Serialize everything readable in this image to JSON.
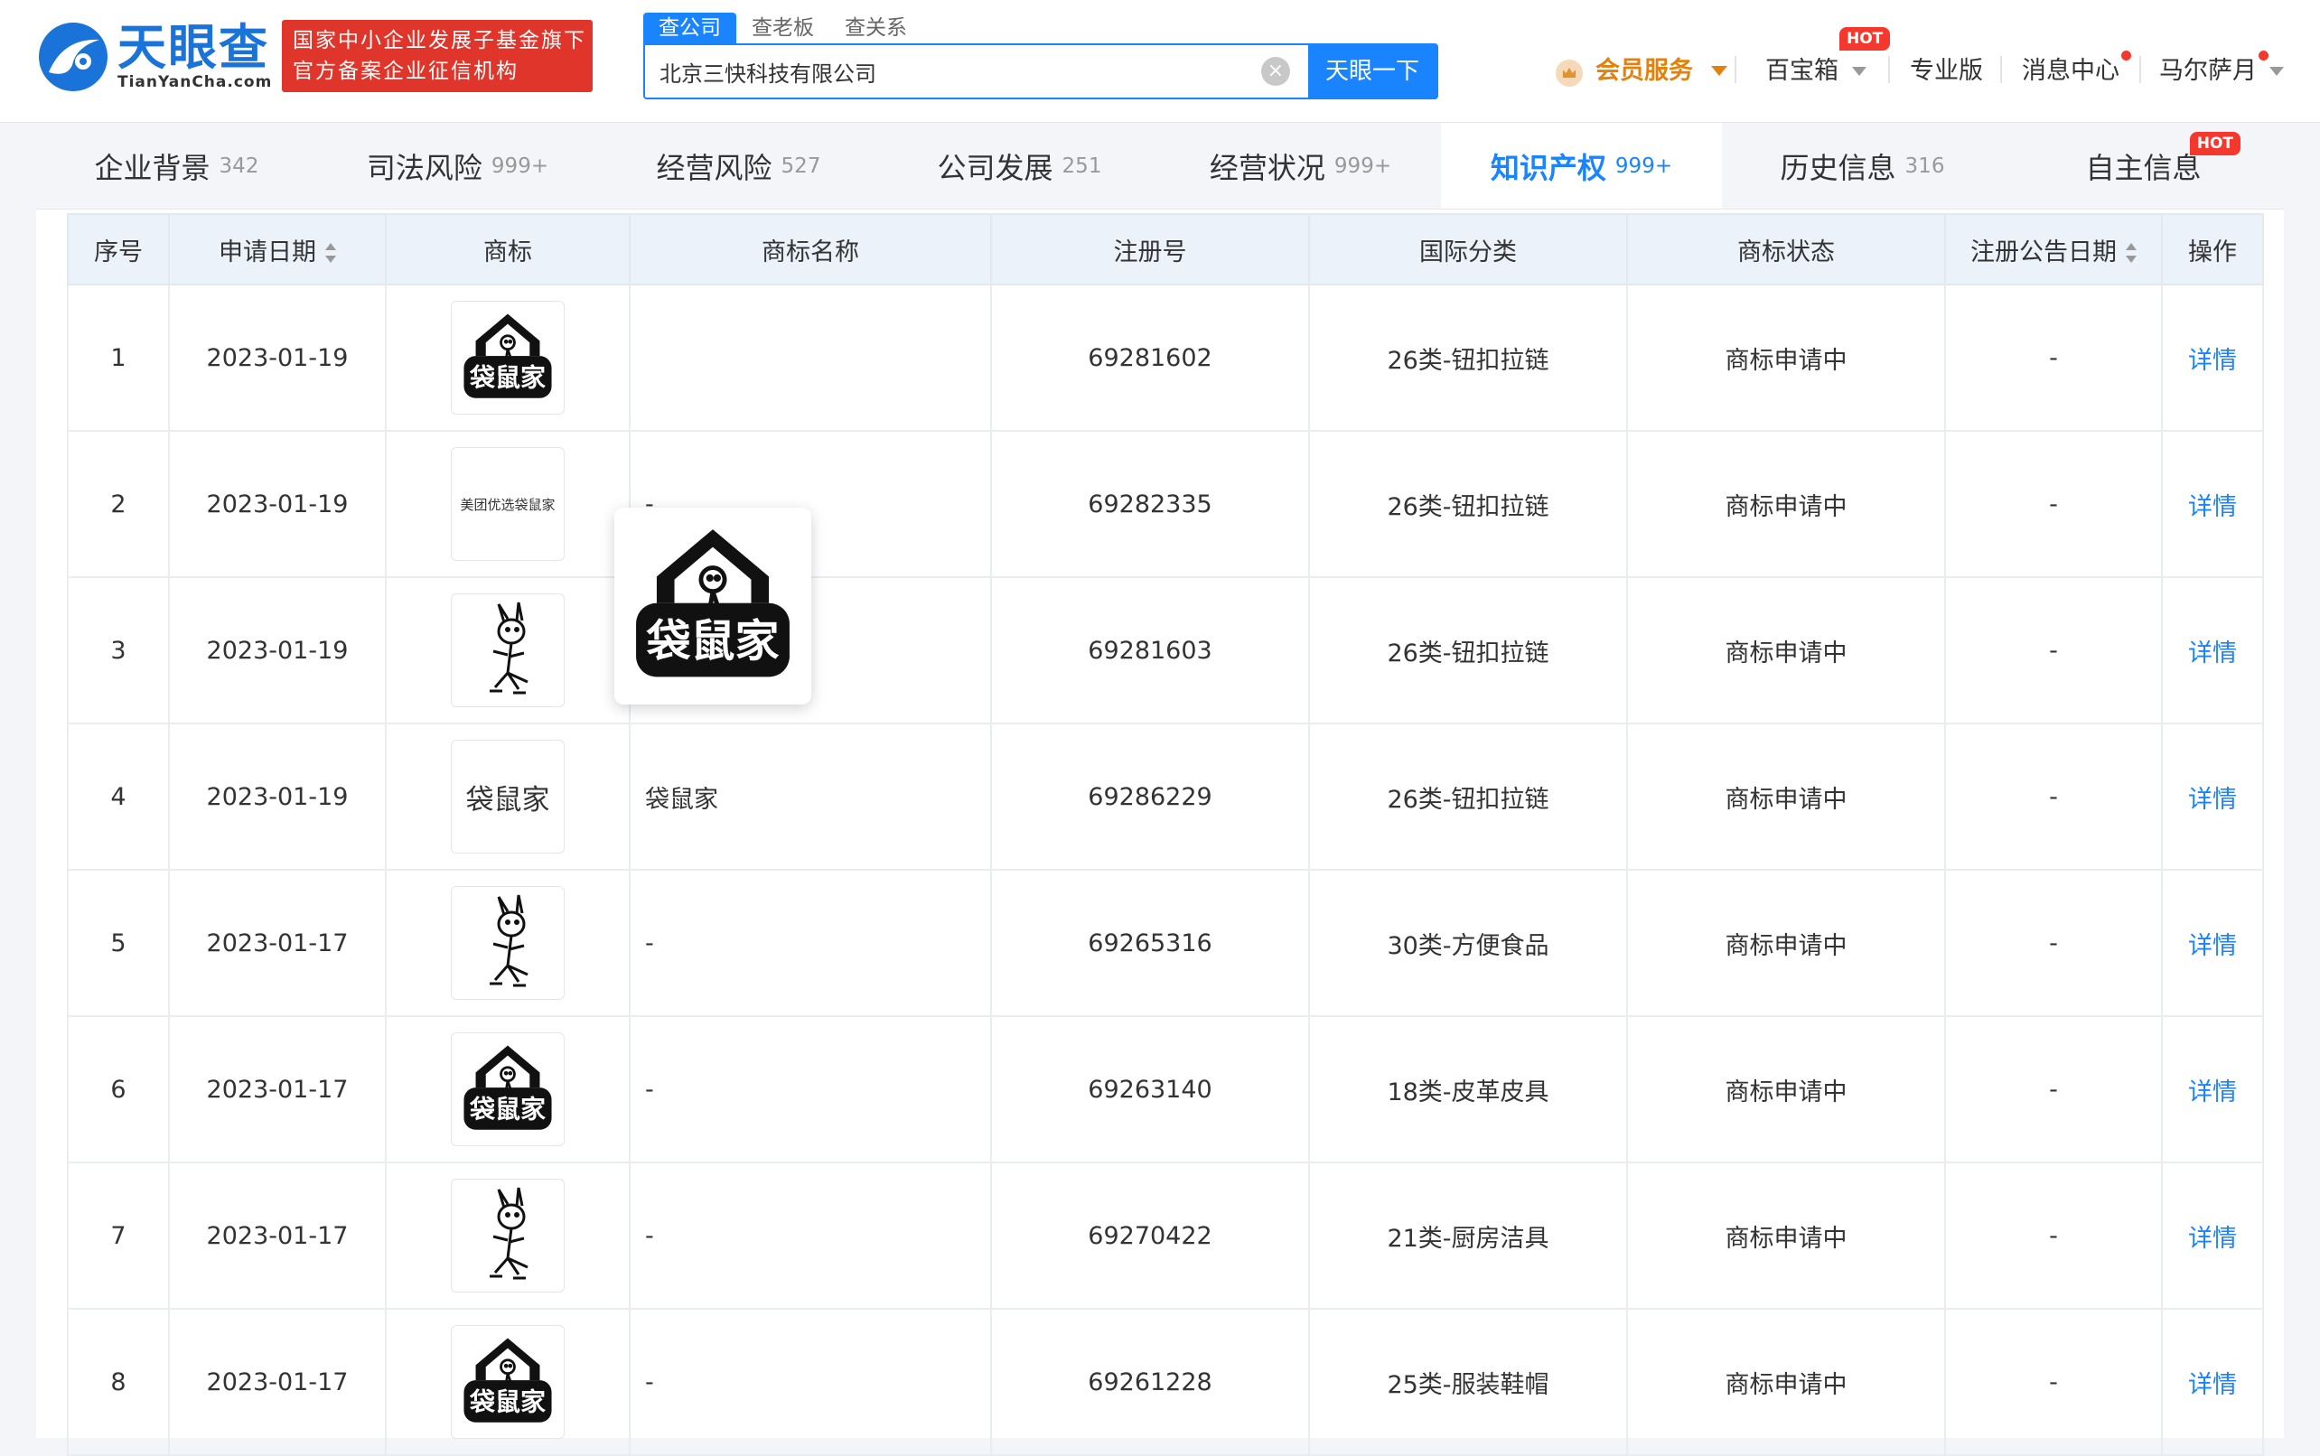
{
  "header": {
    "logo_cn": "天眼查",
    "logo_en": "TianYanCha.com",
    "badge_line1": "国家中小企业发展子基金旗下",
    "badge_line2": "官方备案企业征信机构"
  },
  "search": {
    "tabs": [
      "查公司",
      "查老板",
      "查关系"
    ],
    "value": "北京三快科技有限公司",
    "button": "天眼一下",
    "clear_icon": "×"
  },
  "nav": {
    "member": "会员服务",
    "toolbox": "百宝箱",
    "toolbox_badge": "HOT",
    "pro": "专业版",
    "messages": "消息中心",
    "user": "马尔萨月"
  },
  "tabs": [
    {
      "label": "企业背景",
      "count": "342"
    },
    {
      "label": "司法风险",
      "count": "999+"
    },
    {
      "label": "经营风险",
      "count": "527"
    },
    {
      "label": "公司发展",
      "count": "251"
    },
    {
      "label": "经营状况",
      "count": "999+"
    },
    {
      "label": "知识产权",
      "count": "999+"
    },
    {
      "label": "历史信息",
      "count": "316"
    },
    {
      "label": "自主信息",
      "count": "",
      "badge": "HOT"
    }
  ],
  "table": {
    "headers": [
      "序号",
      "申请日期",
      "商标",
      "商标名称",
      "注册号",
      "国际分类",
      "商标状态",
      "注册公告日期",
      "操作"
    ],
    "rows": [
      {
        "no": "1",
        "date": "2023-01-19",
        "logo": "house-logo",
        "name": "",
        "reg": "69281602",
        "cls": "26类-钮扣拉链",
        "status": "商标申请中",
        "pub": "-",
        "op": "详情"
      },
      {
        "no": "2",
        "date": "2023-01-19",
        "logo": "text-small",
        "logo_text": "美团优选袋鼠家",
        "name": "-",
        "reg": "69282335",
        "cls": "26类-钮扣拉链",
        "status": "商标申请中",
        "pub": "-",
        "op": "详情"
      },
      {
        "no": "3",
        "date": "2023-01-19",
        "logo": "kangaroo",
        "name": "-",
        "reg": "69281603",
        "cls": "26类-钮扣拉链",
        "status": "商标申请中",
        "pub": "-",
        "op": "详情"
      },
      {
        "no": "4",
        "date": "2023-01-19",
        "logo": "text-big",
        "logo_text": "袋鼠家",
        "name": "袋鼠家",
        "reg": "69286229",
        "cls": "26类-钮扣拉链",
        "status": "商标申请中",
        "pub": "-",
        "op": "详情"
      },
      {
        "no": "5",
        "date": "2023-01-17",
        "logo": "kangaroo",
        "name": "-",
        "reg": "69265316",
        "cls": "30类-方便食品",
        "status": "商标申请中",
        "pub": "-",
        "op": "详情"
      },
      {
        "no": "6",
        "date": "2023-01-17",
        "logo": "house-logo",
        "name": "-",
        "reg": "69263140",
        "cls": "18类-皮革皮具",
        "status": "商标申请中",
        "pub": "-",
        "op": "详情"
      },
      {
        "no": "7",
        "date": "2023-01-17",
        "logo": "kangaroo",
        "name": "-",
        "reg": "69270422",
        "cls": "21类-厨房洁具",
        "status": "商标申请中",
        "pub": "-",
        "op": "详情"
      },
      {
        "no": "8",
        "date": "2023-01-17",
        "logo": "house-logo",
        "name": "-",
        "reg": "69261228",
        "cls": "25类-服装鞋帽",
        "status": "商标申请中",
        "pub": "-",
        "op": "详情"
      }
    ]
  },
  "popup": {
    "logo_text": "袋鼠家"
  },
  "colors": {
    "brand": "#1a84ff",
    "badge_red": "#e0352b",
    "member_orange": "#e0820d",
    "hot_red": "#f5382e"
  }
}
